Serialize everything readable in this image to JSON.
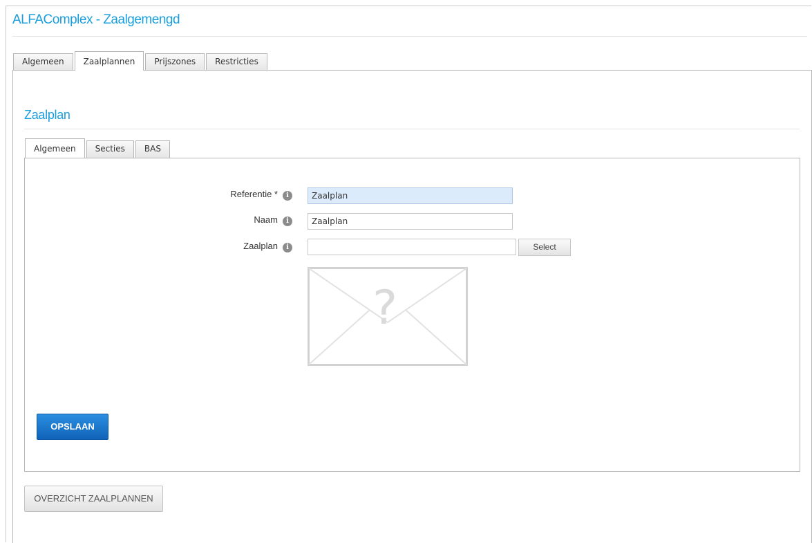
{
  "app": {
    "title": "ALFAComplex - Zaalgemengd"
  },
  "top_tabs": [
    {
      "label": "Algemeen",
      "active": false
    },
    {
      "label": "Zaalplannen",
      "active": true
    },
    {
      "label": "Prijszones",
      "active": false
    },
    {
      "label": "Restricties",
      "active": false
    }
  ],
  "section": {
    "title": "Zaalplan"
  },
  "inner_tabs": [
    {
      "label": "Algemeen",
      "active": true
    },
    {
      "label": "Secties",
      "active": false
    },
    {
      "label": "BAS",
      "active": false
    }
  ],
  "form": {
    "referentie": {
      "label": "Referentie *",
      "value": "Zaalplan",
      "info_icon": "info-icon"
    },
    "naam": {
      "label": "Naam",
      "value": "Zaalplan",
      "info_icon": "info-icon"
    },
    "zaalplan": {
      "label": "Zaalplan",
      "value": "",
      "info_icon": "info-icon",
      "select_label": "Select"
    },
    "image_placeholder_icon": "missing-image-icon"
  },
  "buttons": {
    "save": "OPSLAAN",
    "overview": "OVERZICHT ZAALPLANNEN"
  },
  "colors": {
    "accent": "#1a9fdc",
    "primary_button": "#1a74cc",
    "focused_field": "#dcebfb"
  }
}
